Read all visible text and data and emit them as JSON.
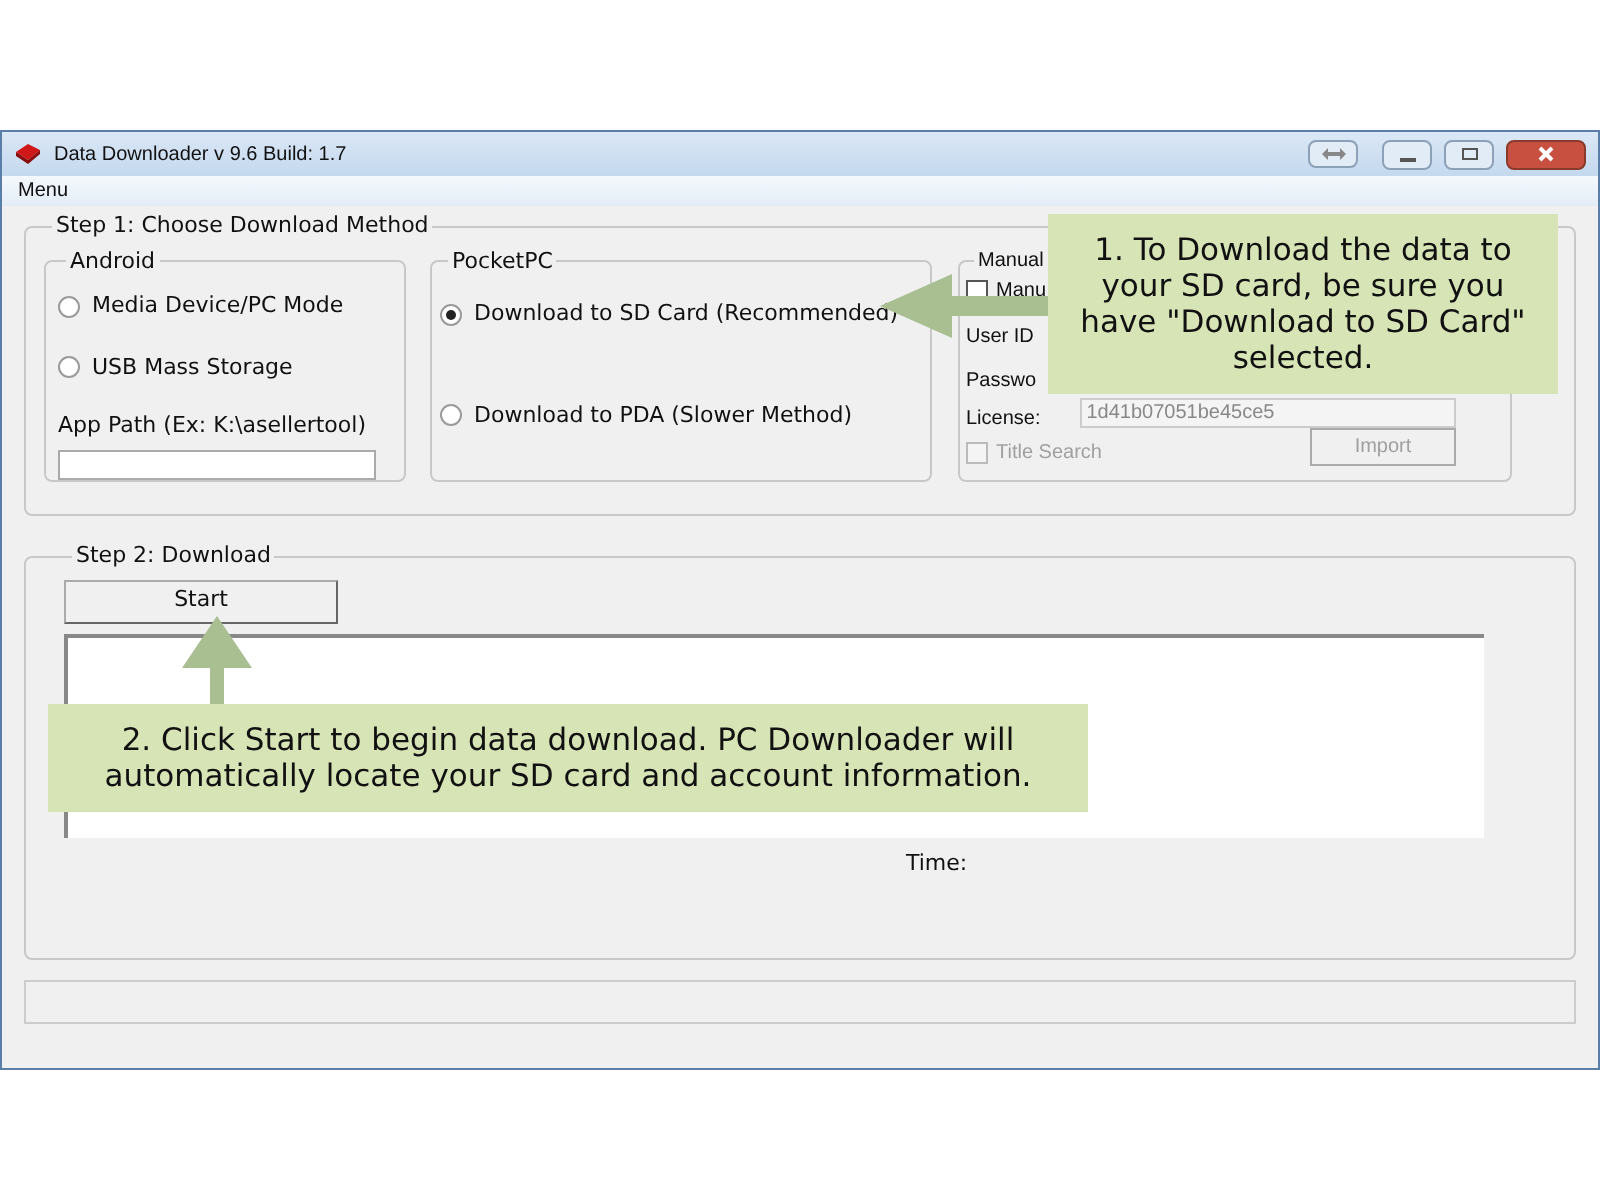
{
  "window": {
    "title": "Data Downloader v 9.6 Build: 1.7"
  },
  "menu": [
    "Menu"
  ],
  "step1": {
    "title": "Step 1: Choose Download Method",
    "android": {
      "title": "Android",
      "options": [
        {
          "label": "Media Device/PC Mode",
          "selected": false
        },
        {
          "label": "USB Mass Storage",
          "selected": false
        }
      ],
      "path_label": "App Path (Ex: K:\\asellertool)"
    },
    "pocketpc": {
      "title": "PocketPC",
      "options": [
        {
          "label": "Download to SD Card (Recommended)",
          "selected": true
        },
        {
          "label": "Download to PDA (Slower Method)",
          "selected": false
        }
      ]
    },
    "manual": {
      "title": "Manual",
      "checkbox": {
        "label": "Manu",
        "checked": false,
        "disabled": false
      },
      "user_id_label": "User ID",
      "password_label": "Passwo",
      "license_label": "License:",
      "license_value": "1d41b07051be45ce5",
      "title_search": {
        "label": "Title Search",
        "checked": false,
        "disabled": true
      },
      "import_button": {
        "label": "Import",
        "disabled": true
      }
    }
  },
  "step2": {
    "title": "Step 2: Download",
    "start_button": "Start",
    "time_label": "Time:"
  },
  "callouts": [
    {
      "text": "1. To Download the data to your SD card, be sure you have \"Download to SD Card\" selected."
    },
    {
      "text": "2. Click Start to begin data download. PC Downloader will automatically locate your SD card and account information."
    }
  ]
}
